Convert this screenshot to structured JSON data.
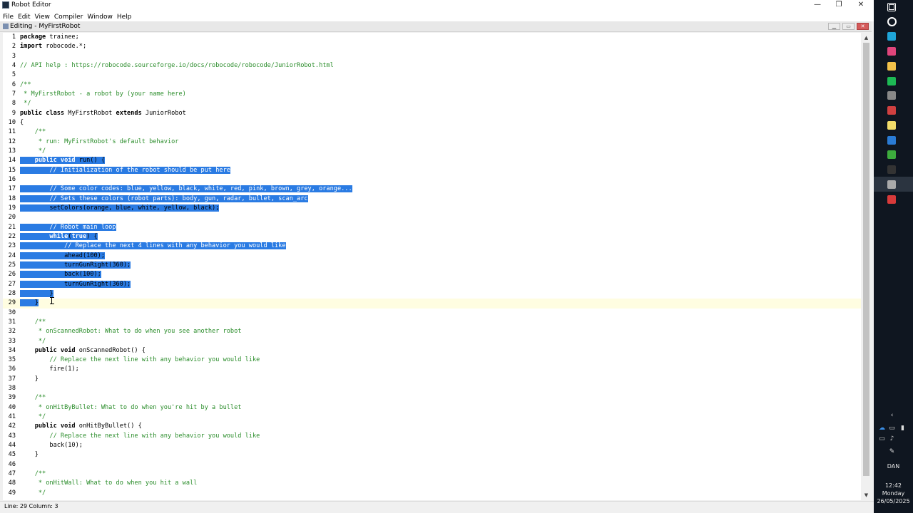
{
  "window": {
    "title": "Robot Editor",
    "controls": {
      "minimize": "—",
      "maximize": "❐",
      "close": "✕"
    }
  },
  "menubar": [
    "File",
    "Edit",
    "View",
    "Compiler",
    "Window",
    "Help"
  ],
  "inner_window": {
    "title": "Editing - MyFirstRobot"
  },
  "editor": {
    "current_line": 29,
    "lines": [
      {
        "n": "1",
        "t": [
          [
            "kw",
            "package"
          ],
          [
            "pl",
            " trainee;"
          ]
        ]
      },
      {
        "n": "2",
        "t": [
          [
            "kw",
            "import"
          ],
          [
            "pl",
            " robocode.*;"
          ]
        ]
      },
      {
        "n": "3",
        "t": []
      },
      {
        "n": "4",
        "t": [
          [
            "cm",
            "// API help : https://robocode.sourceforge.io/docs/robocode/robocode/JuniorRobot.html"
          ]
        ]
      },
      {
        "n": "5",
        "t": []
      },
      {
        "n": "6",
        "t": [
          [
            "cm",
            "/**"
          ]
        ]
      },
      {
        "n": "7",
        "t": [
          [
            "cm",
            " * MyFirstRobot - a robot by (your name here)"
          ]
        ]
      },
      {
        "n": "8",
        "t": [
          [
            "cm",
            " */"
          ]
        ]
      },
      {
        "n": "9",
        "t": [
          [
            "kw",
            "public class"
          ],
          [
            "pl",
            " MyFirstRobot "
          ],
          [
            "kw",
            "extends"
          ],
          [
            "pl",
            " JuniorRobot"
          ]
        ]
      },
      {
        "n": "10",
        "t": [
          [
            "pl",
            "{"
          ]
        ]
      },
      {
        "n": "11",
        "t": [
          [
            "cm",
            "    /**"
          ]
        ]
      },
      {
        "n": "12",
        "t": [
          [
            "cm",
            "     * run: MyFirstRobot's default behavior"
          ]
        ]
      },
      {
        "n": "13",
        "t": [
          [
            "cm",
            "     */"
          ]
        ]
      },
      {
        "n": "14",
        "sel": true,
        "t": [
          [
            "kw",
            "    public void"
          ],
          [
            "pl",
            " run() {"
          ]
        ]
      },
      {
        "n": "15",
        "sel": true,
        "t": [
          [
            "cm",
            "        // Initialization of the robot should be put here"
          ]
        ]
      },
      {
        "n": "16",
        "t": []
      },
      {
        "n": "17",
        "sel": true,
        "t": [
          [
            "cm",
            "        // Some color codes: blue, yellow, black, white, red, pink, brown, grey, orange..."
          ]
        ]
      },
      {
        "n": "18",
        "sel": true,
        "t": [
          [
            "cm",
            "        // Sets these colors (robot parts): body, gun, radar, bullet, scan_arc"
          ]
        ]
      },
      {
        "n": "19",
        "sel": true,
        "t": [
          [
            "pl",
            "        setColors(orange, blue, white, yellow, black);"
          ]
        ]
      },
      {
        "n": "20",
        "t": []
      },
      {
        "n": "21",
        "sel": true,
        "t": [
          [
            "cm",
            "        // Robot main loop"
          ]
        ]
      },
      {
        "n": "22",
        "sel": true,
        "t": [
          [
            "kw",
            "        while"
          ],
          [
            "pl",
            "("
          ],
          [
            "kw",
            "true"
          ],
          [
            "pl",
            ") {"
          ]
        ]
      },
      {
        "n": "23",
        "sel": true,
        "t": [
          [
            "cm",
            "            // Replace the next 4 lines with any behavior you would like"
          ]
        ]
      },
      {
        "n": "24",
        "sel": true,
        "t": [
          [
            "pl",
            "            ahead(100);"
          ]
        ]
      },
      {
        "n": "25",
        "sel": true,
        "t": [
          [
            "pl",
            "            turnGunRight(360);"
          ]
        ]
      },
      {
        "n": "26",
        "sel": true,
        "t": [
          [
            "pl",
            "            back(100);"
          ]
        ]
      },
      {
        "n": "27",
        "sel": true,
        "t": [
          [
            "pl",
            "            turnGunRight(360);"
          ]
        ]
      },
      {
        "n": "28",
        "sel": true,
        "t": [
          [
            "pl",
            "        }"
          ]
        ]
      },
      {
        "n": "29",
        "sel": true,
        "t": [
          [
            "pl",
            "    }"
          ]
        ]
      },
      {
        "n": "30",
        "t": []
      },
      {
        "n": "31",
        "t": [
          [
            "cm",
            "    /**"
          ]
        ]
      },
      {
        "n": "32",
        "t": [
          [
            "cm",
            "     * onScannedRobot: What to do when you see another robot"
          ]
        ]
      },
      {
        "n": "33",
        "t": [
          [
            "cm",
            "     */"
          ]
        ]
      },
      {
        "n": "34",
        "t": [
          [
            "kw",
            "    public void"
          ],
          [
            "pl",
            " onScannedRobot() {"
          ]
        ]
      },
      {
        "n": "35",
        "t": [
          [
            "cm",
            "        // Replace the next line with any behavior you would like"
          ]
        ]
      },
      {
        "n": "36",
        "t": [
          [
            "pl",
            "        fire(1);"
          ]
        ]
      },
      {
        "n": "37",
        "t": [
          [
            "pl",
            "    }"
          ]
        ]
      },
      {
        "n": "38",
        "t": []
      },
      {
        "n": "39",
        "t": [
          [
            "cm",
            "    /**"
          ]
        ]
      },
      {
        "n": "40",
        "t": [
          [
            "cm",
            "     * onHitByBullet: What to do when you're hit by a bullet"
          ]
        ]
      },
      {
        "n": "41",
        "t": [
          [
            "cm",
            "     */"
          ]
        ]
      },
      {
        "n": "42",
        "t": [
          [
            "kw",
            "    public void"
          ],
          [
            "pl",
            " onHitByBullet() {"
          ]
        ]
      },
      {
        "n": "43",
        "t": [
          [
            "cm",
            "        // Replace the next line with any behavior you would like"
          ]
        ]
      },
      {
        "n": "44",
        "t": [
          [
            "pl",
            "        back(10);"
          ]
        ]
      },
      {
        "n": "45",
        "t": [
          [
            "pl",
            "    }"
          ]
        ]
      },
      {
        "n": "46",
        "t": []
      },
      {
        "n": "47",
        "t": [
          [
            "cm",
            "    /**"
          ]
        ]
      },
      {
        "n": "48",
        "t": [
          [
            "cm",
            "     * onHitWall: What to do when you hit a wall"
          ]
        ]
      },
      {
        "n": "49",
        "t": [
          [
            "cm",
            "     */"
          ]
        ]
      }
    ]
  },
  "statusbar": {
    "text": "Line: 29 Column: 3"
  },
  "taskbar": {
    "icons": [
      {
        "name": "windows-start-icon",
        "color": "#ffffff"
      },
      {
        "name": "search-icon",
        "color": "#ffffff"
      },
      {
        "name": "edge-icon",
        "color": "#1fa5d8"
      },
      {
        "name": "chrome-icon",
        "color": "#e0457b"
      },
      {
        "name": "file-explorer-icon",
        "color": "#f3c24a"
      },
      {
        "name": "spotify-icon",
        "color": "#1db954"
      },
      {
        "name": "app-icon",
        "color": "#888888"
      },
      {
        "name": "media-icon",
        "color": "#d04040"
      },
      {
        "name": "notepad-icon",
        "color": "#f2dc6a"
      },
      {
        "name": "outlook-icon",
        "color": "#2a7bd4"
      },
      {
        "name": "green-app-icon",
        "color": "#3dab3d"
      },
      {
        "name": "terminal-icon",
        "color": "#333333"
      },
      {
        "name": "robocode-icon",
        "color": "#aaaaaa"
      },
      {
        "name": "red-app-icon",
        "color": "#d83a3a"
      }
    ],
    "lang": "DAN",
    "time": "12:42",
    "day": "Monday",
    "date": "26/05/2025"
  }
}
